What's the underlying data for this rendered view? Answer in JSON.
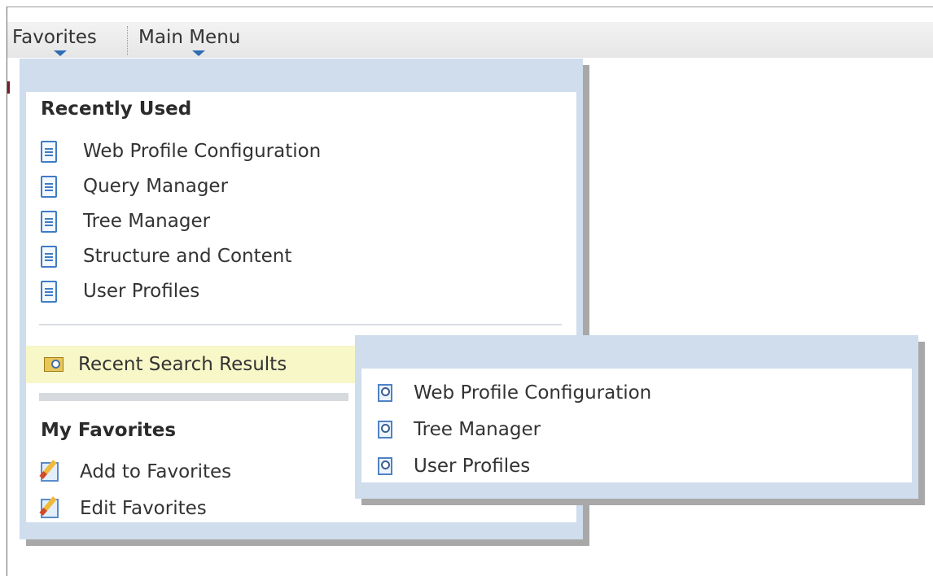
{
  "menubar": {
    "favorites_label": "Favorites",
    "main_menu_label": "Main Menu"
  },
  "favorites_menu": {
    "recently_used_title": "Recently Used",
    "recently_used_items": [
      {
        "label": "Web Profile Configuration",
        "icon": "document-icon"
      },
      {
        "label": "Query Manager",
        "icon": "document-icon"
      },
      {
        "label": "Tree Manager",
        "icon": "document-icon"
      },
      {
        "label": "Structure and Content",
        "icon": "document-icon"
      },
      {
        "label": "User Profiles",
        "icon": "document-icon"
      }
    ],
    "recent_search_results_label": "Recent Search Results",
    "my_favorites_title": "My Favorites",
    "my_favorites_items": [
      {
        "label": "Add to Favorites",
        "icon": "edit-pencil-icon"
      },
      {
        "label": "Edit Favorites",
        "icon": "edit-pencil-icon"
      }
    ]
  },
  "recent_search_submenu": {
    "items": [
      {
        "label": "Web Profile Configuration",
        "icon": "search-document-icon"
      },
      {
        "label": "Tree Manager",
        "icon": "search-document-icon"
      },
      {
        "label": "User Profiles",
        "icon": "search-document-icon"
      }
    ]
  },
  "colors": {
    "menu_panel_border": "#cfdded",
    "highlight_row": "#f7f7c8",
    "tab_arrow": "#2e6db4"
  }
}
